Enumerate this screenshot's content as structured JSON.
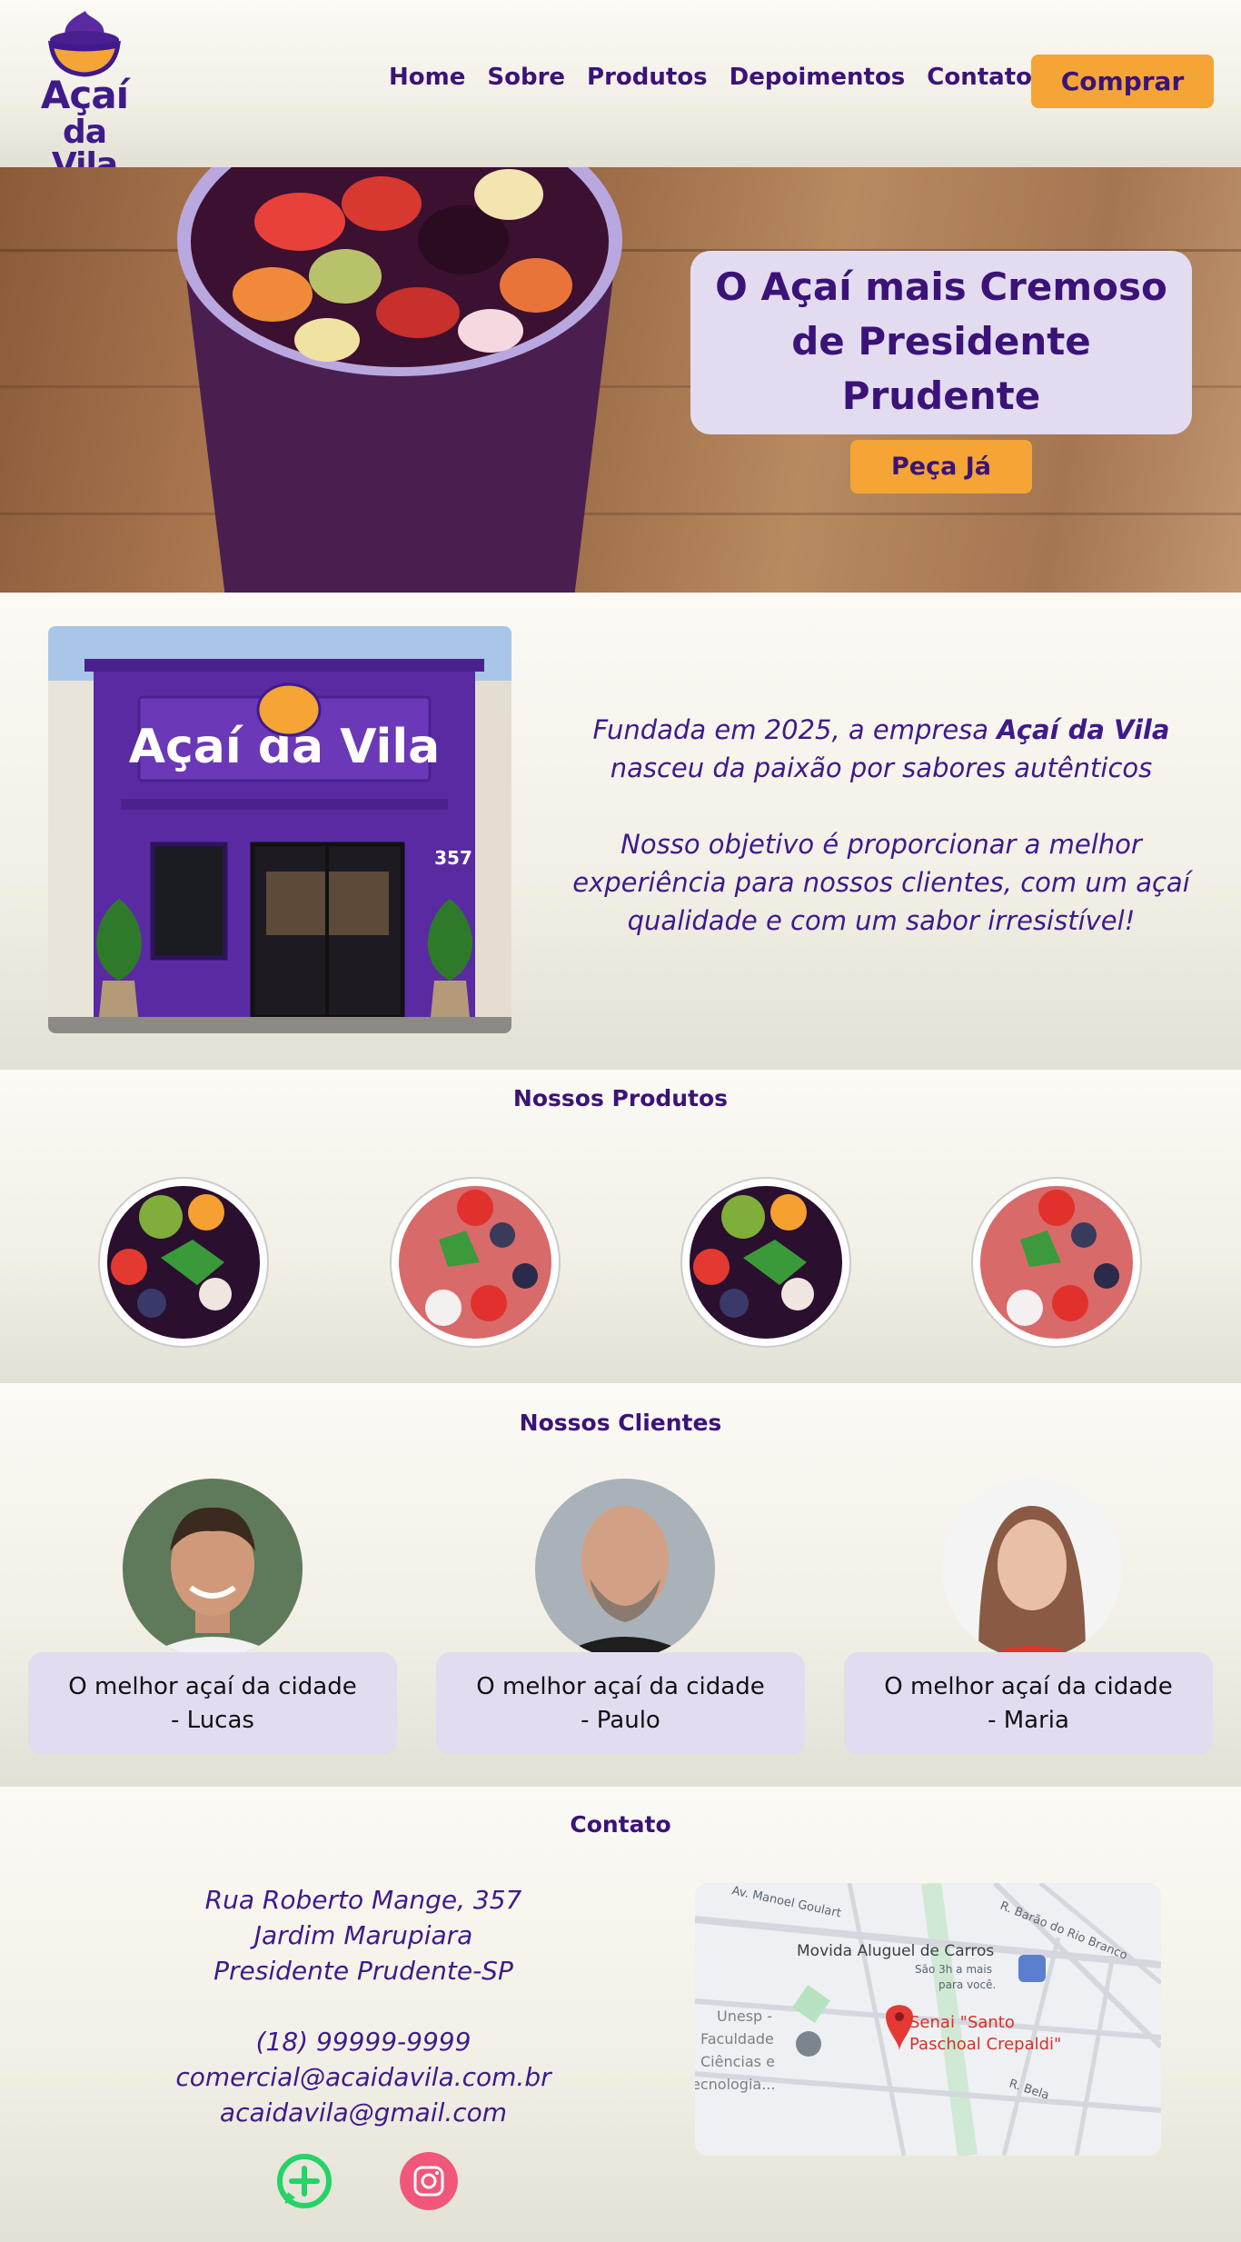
{
  "header": {
    "logo_line1": "Açaí",
    "logo_line2": "da Vila",
    "nav": [
      "Home",
      "Sobre",
      "Produtos",
      "Depoimentos",
      "Contato"
    ],
    "buy_label": "Comprar"
  },
  "hero": {
    "title_line1": "O Açaí mais Cremoso",
    "title_line2": "de Presidente Prudente",
    "order_label": "Peça Já"
  },
  "about": {
    "store_sign": "Açaí da Vila",
    "store_number": "357",
    "p1_prefix": "Fundada em 2025, a empresa ",
    "p1_brand": "Açaí da Vila",
    "p1_suffix": " nasceu da paixão por sabores autênticos",
    "p2": "Nosso objetivo é proporcionar a melhor experiência para nossos clientes, com um açaí qualidade e com um sabor irresistível!"
  },
  "products": {
    "title": "Nossos Produtos"
  },
  "clients": {
    "title": "Nossos Clientes",
    "testimonials": [
      {
        "quote": "O melhor açaí da cidade",
        "author": "- Lucas"
      },
      {
        "quote": "O melhor açaí da cidade",
        "author": "- Paulo"
      },
      {
        "quote": "O melhor açaí da cidade",
        "author": "- Maria"
      }
    ]
  },
  "contact": {
    "title": "Contato",
    "street": "Rua Roberto Mange, 357",
    "district": "Jardim Marupiara",
    "city": "Presidente Prudente-SP",
    "phone": "(18) 99999-9999",
    "email1": "comercial@acaidavila.com.br",
    "email2": "acaidavila@gmail.com",
    "map": {
      "street_top": "Av. Manoel Goulart",
      "street_right": "R. Barão do Rio Branco",
      "place1": "Movida Aluguel de Carros",
      "place1_sub1": "São 3h a mais",
      "place1_sub2": "para você.",
      "place2_l1": "Unesp -",
      "place2_l2": "Faculdade",
      "place2_l3": "Ciências e",
      "place2_l4": "ecnologia...",
      "pin_l1": "Senai \"Santo",
      "pin_l2": "Paschoal Crepaldi\"",
      "street_bottom": "R. Bela"
    },
    "icons": [
      "whatsapp-icon",
      "instagram-icon"
    ]
  },
  "colors": {
    "purple": "#3b1378",
    "orange": "#f5a436",
    "lavender": "#e3dcf1",
    "cream": "#faf8f2"
  }
}
